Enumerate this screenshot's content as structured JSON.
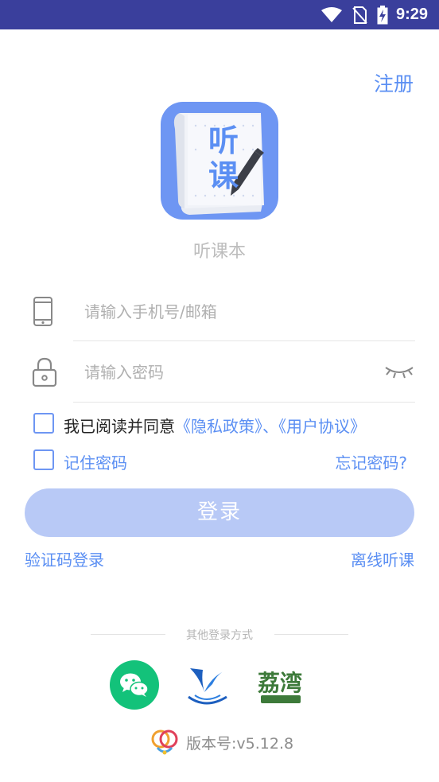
{
  "status_bar": {
    "time": "9:29",
    "icons": [
      "wifi-icon",
      "no-sim-icon",
      "battery-charging-icon"
    ]
  },
  "header": {
    "register_label": "注册"
  },
  "app": {
    "logo_text_top": "听",
    "logo_text_bottom": "课",
    "name": "听课本",
    "accent_color": "#6e96f3"
  },
  "form": {
    "account_placeholder": "请输入手机号/邮箱",
    "account_value": "",
    "password_placeholder": "请输入密码",
    "password_value": ""
  },
  "agreement": {
    "prefix": "我已阅读并同意",
    "privacy_policy": "《隐私政策》",
    "separator": "、",
    "user_agreement": "《用户协议》",
    "checked": false
  },
  "remember": {
    "label": "记住密码",
    "checked": false
  },
  "forgot_password_label": "忘记密码?",
  "login_button_label": "登录",
  "sms_login_label": "验证码登录",
  "offline_label": "离线听课",
  "other_login": {
    "label": "其他登录方式",
    "providers": [
      "wechat-icon",
      "partner-v-icon",
      "lizhi-icon"
    ],
    "lizhi_logo_text": "荔湾"
  },
  "version_text": "版本号:v5.12.8"
}
